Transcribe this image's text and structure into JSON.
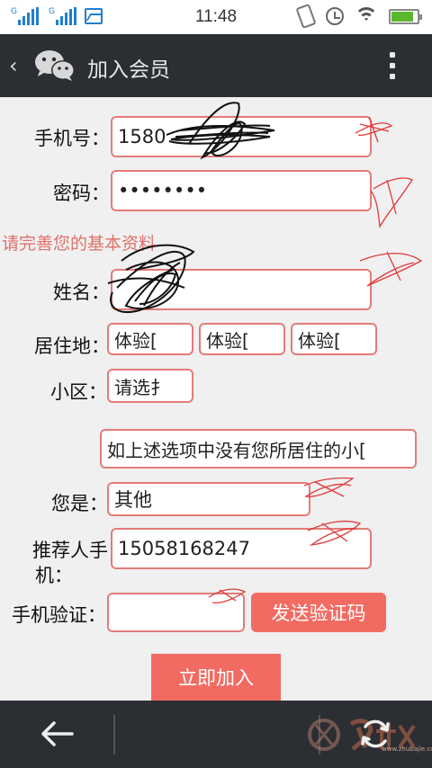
{
  "status_bar": {
    "time": "11:48",
    "carrier_labels": [
      "G",
      "G"
    ]
  },
  "header": {
    "title": "加入会员"
  },
  "form": {
    "phone_label": "手机号：",
    "phone_value": "1580",
    "password_label": "密码：",
    "password_value": "••••••••",
    "notice": "请完善您的基本资料",
    "name_label": "姓名：",
    "residence_label": "居住地：",
    "residence_selects": [
      "体验[",
      "体验[",
      "体验["
    ],
    "community_label": "小区：",
    "community_select": "请选扌",
    "other_community_value": "如上述选项中没有您所居住的小[",
    "identity_label": "您是：",
    "identity_value": "其他",
    "referrer_label_line1": "推荐人手",
    "referrer_label_line2": "机：",
    "referrer_value": "15058168247",
    "verify_label": "手机验证：",
    "verify_value": "",
    "send_code_button": "发送验证码",
    "submit_button": "立即加入"
  },
  "watermark": {
    "text": "www.zhubajie.com"
  },
  "colors": {
    "accent": "#f26b63",
    "field_border": "#e37c78",
    "title_bar": "#2b2e33",
    "notice": "#e0706a"
  }
}
